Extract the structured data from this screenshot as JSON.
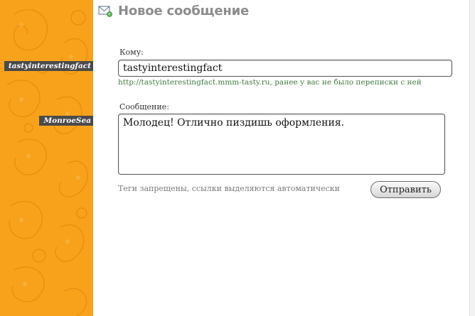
{
  "sidebar": {
    "users": [
      "tastyinterestingfact",
      "MonroeSea"
    ]
  },
  "header": {
    "title": "Новое сообщение",
    "icon": "envelope-icon"
  },
  "form": {
    "to_label": "Кому:",
    "to_value": "tastyinterestingfact",
    "to_hint": "http://tastyinterestingfact.mmm-tasty.ru, ранее у вас не было переписки с ней",
    "message_label": "Сообщение:",
    "message_value": "Молодец! Отлично пиздишь оформления.",
    "note": "Теги запрещены, ссылки выделяются автоматически",
    "send_label": "Отправить"
  },
  "colors": {
    "sidebar_orange": "#f8a21c",
    "tag_bg": "#4a4a4a",
    "hint_green": "#3f7d3f",
    "title_gray": "#8c8c8c"
  }
}
